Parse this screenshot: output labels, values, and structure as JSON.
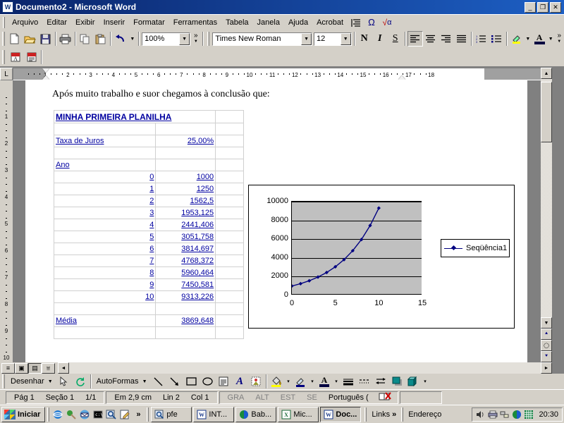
{
  "window": {
    "title": "Documento2 - Microsoft Word",
    "app_icon": "word-icon",
    "minimize": "_",
    "maximize": "❐",
    "close": "✕"
  },
  "menu": {
    "items": [
      {
        "label": "Arquivo",
        "accel": "A"
      },
      {
        "label": "Editar",
        "accel": "E"
      },
      {
        "label": "Exibir",
        "accel": "x"
      },
      {
        "label": "Inserir",
        "accel": "I"
      },
      {
        "label": "Formatar",
        "accel": "F"
      },
      {
        "label": "Ferramentas",
        "accel": "m"
      },
      {
        "label": "Tabela",
        "accel": "b"
      },
      {
        "label": "Janela",
        "accel": "J"
      },
      {
        "label": "Ajuda",
        "accel": "u"
      },
      {
        "label": "Acrobat",
        "accel": "b"
      }
    ],
    "extra_icons": [
      "paragraph-marks-icon",
      "omega-symbol-icon",
      "sqrt-alpha-icon"
    ]
  },
  "toolbar_standard": {
    "buttons": [
      {
        "name": "new-document-button",
        "glyph": "🗋"
      },
      {
        "name": "open-document-button",
        "glyph": "📂"
      },
      {
        "name": "save-button",
        "glyph": "💾"
      },
      {
        "name": "print-button",
        "glyph": "🖨"
      },
      {
        "name": "copy-button",
        "glyph": "⧉"
      },
      {
        "name": "paste-button",
        "glyph": "📋"
      },
      {
        "name": "undo-button",
        "glyph": "↰"
      }
    ],
    "zoom_value": "100%",
    "overflow_label": "»"
  },
  "toolbar_formatting": {
    "font_name": "Times New Roman",
    "font_size": "12",
    "bold_label": "N",
    "italic_label": "I",
    "underline_label": "S",
    "align_buttons": [
      "align-left",
      "align-center",
      "align-right",
      "align-justify"
    ],
    "list_buttons": [
      "numbered-list",
      "bulleted-list"
    ],
    "highlight_label": "highlight-color",
    "fontcolor_label": "A",
    "overflow_label": "»"
  },
  "toolbar_acrobat": {
    "buttons": [
      {
        "name": "convert-to-pdf-button",
        "glyph": "A"
      },
      {
        "name": "convert-and-email-pdf-button",
        "glyph": "A"
      }
    ]
  },
  "ruler": {
    "horizontal_ticks": [
      "1",
      "2",
      "3",
      "4",
      "5",
      "6",
      "7",
      "8",
      "9",
      "10",
      "11",
      "12",
      "13",
      "14",
      "15",
      "16",
      "17",
      "18"
    ],
    "vertical_ticks": [
      "1",
      "2",
      "3",
      "4",
      "5",
      "6",
      "7",
      "8",
      "9",
      "10"
    ],
    "corner_label": "L"
  },
  "document": {
    "paragraph": "Após muito trabalho e suor chegamos à conclusão que:",
    "spreadsheet": {
      "title": "MINHA PRIMEIRA PLANILHA",
      "rate_label": "Taxa de Juros",
      "rate_value": "25,00%",
      "year_header": "Ano",
      "rows": [
        {
          "year": "0",
          "value": "1000"
        },
        {
          "year": "1",
          "value": "1250"
        },
        {
          "year": "2",
          "value": "1562,5"
        },
        {
          "year": "3",
          "value": "1953,125"
        },
        {
          "year": "4",
          "value": "2441,406"
        },
        {
          "year": "5",
          "value": "3051,758"
        },
        {
          "year": "6",
          "value": "3814,697"
        },
        {
          "year": "7",
          "value": "4768,372"
        },
        {
          "year": "8",
          "value": "5960,464"
        },
        {
          "year": "9",
          "value": "7450,581"
        },
        {
          "year": "10",
          "value": "9313,226"
        }
      ],
      "average_label": "Média",
      "average_value": "3869,648"
    }
  },
  "chart_data": {
    "type": "line",
    "title": "",
    "xlabel": "",
    "ylabel": "",
    "x": [
      0,
      1,
      2,
      3,
      4,
      5,
      6,
      7,
      8,
      9,
      10
    ],
    "series": [
      {
        "name": "Seqüência1",
        "values": [
          1000,
          1250,
          1562.5,
          1953.125,
          2441.406,
          3051.758,
          3814.697,
          4768.372,
          5960.464,
          7450.581,
          9313.226
        ],
        "color": "#000080",
        "marker": "diamond"
      }
    ],
    "xlim": [
      0,
      15
    ],
    "ylim": [
      0,
      10000
    ],
    "xticks": [
      "0",
      "5",
      "10",
      "15"
    ],
    "yticks": [
      "0",
      "2000",
      "4000",
      "6000",
      "8000",
      "10000"
    ],
    "grid": "horizontal",
    "legend_position": "right",
    "plot_background": "#c0c0c0",
    "chart_background": "#ffffff"
  },
  "scrollbars": {
    "up_arrow": "▲",
    "down_arrow": "▼",
    "left_arrow": "◄",
    "right_arrow": "►",
    "prev_object": "⯅",
    "select_object": "◯",
    "next_object": "⯆"
  },
  "view_buttons": [
    {
      "name": "normal-view-button",
      "glyph": "≡"
    },
    {
      "name": "web-layout-view-button",
      "glyph": "▣"
    },
    {
      "name": "print-layout-view-button",
      "glyph": "▤",
      "active": true
    },
    {
      "name": "outline-view-button",
      "glyph": "⩸"
    }
  ],
  "drawing_toolbar": {
    "draw_menu": "Desenhar",
    "autoshapes_menu": "AutoFormas",
    "buttons": [
      {
        "name": "select-objects-button",
        "glyph": "↖"
      },
      {
        "name": "free-rotate-button",
        "glyph": "↻"
      },
      {
        "name": "line-button",
        "glyph": "╲"
      },
      {
        "name": "arrow-button",
        "glyph": "↘"
      },
      {
        "name": "rectangle-button",
        "glyph": "▭"
      },
      {
        "name": "oval-button",
        "glyph": "◯"
      },
      {
        "name": "text-box-button",
        "glyph": "▤"
      },
      {
        "name": "wordart-button",
        "glyph": "A"
      },
      {
        "name": "insert-clipart-button",
        "glyph": "▥"
      },
      {
        "name": "fill-color-button",
        "glyph": "🪣"
      },
      {
        "name": "line-color-button",
        "glyph": "✎"
      },
      {
        "name": "font-color-button",
        "glyph": "A"
      },
      {
        "name": "line-style-button",
        "glyph": "≡"
      },
      {
        "name": "dash-style-button",
        "glyph": "┅"
      },
      {
        "name": "arrow-style-button",
        "glyph": "⇄"
      },
      {
        "name": "shadow-button",
        "glyph": "▣"
      },
      {
        "name": "3d-button",
        "glyph": "▱"
      }
    ],
    "dropdown_arrow": "▾"
  },
  "statusbar": {
    "page": "Pág 1",
    "section": "Seção 1",
    "page_count": "1/1",
    "position": "Em 2,9 cm",
    "line": "Lin 2",
    "column": "Col 1",
    "indicators": [
      "GRA",
      "ALT",
      "EST",
      "SE"
    ],
    "language": "Português (",
    "spellcheck_icon": "spellcheck-error-icon"
  },
  "taskbar": {
    "start_label": "Iniciar",
    "quick_launch": [
      {
        "name": "internet-explorer-icon",
        "glyph": "🌐"
      },
      {
        "name": "show-desktop-icon",
        "glyph": "🖳"
      },
      {
        "name": "outlook-express-icon",
        "glyph": "✉"
      },
      {
        "name": "msdos-prompt-icon",
        "glyph": "▪"
      },
      {
        "name": "search-icon",
        "glyph": "🔍"
      },
      {
        "name": "notepad-icon",
        "glyph": "📝"
      }
    ],
    "quick_launch_overflow": "»",
    "tasks": [
      {
        "label": "pfe",
        "icon": "search-icon",
        "active": false
      },
      {
        "label": "INT...",
        "icon": "word-icon",
        "active": false
      },
      {
        "label": "Bab...",
        "icon": "babylon-icon",
        "active": false
      },
      {
        "label": "Mic...",
        "icon": "excel-icon",
        "active": false
      },
      {
        "label": "Doc...",
        "icon": "word-icon",
        "active": true
      }
    ],
    "toolbars": [
      {
        "label": "Links",
        "overflow": "»"
      },
      {
        "label": "Endereço",
        "overflow": ""
      }
    ],
    "tray_icons": [
      {
        "name": "volume-icon",
        "glyph": "🔊"
      },
      {
        "name": "printer-icon",
        "glyph": "🖨"
      },
      {
        "name": "network-icon",
        "glyph": "🖧"
      },
      {
        "name": "babylon-tray-icon",
        "glyph": "◉"
      },
      {
        "name": "antivirus-tray-icon",
        "glyph": "▩"
      }
    ],
    "clock": "20:30"
  }
}
